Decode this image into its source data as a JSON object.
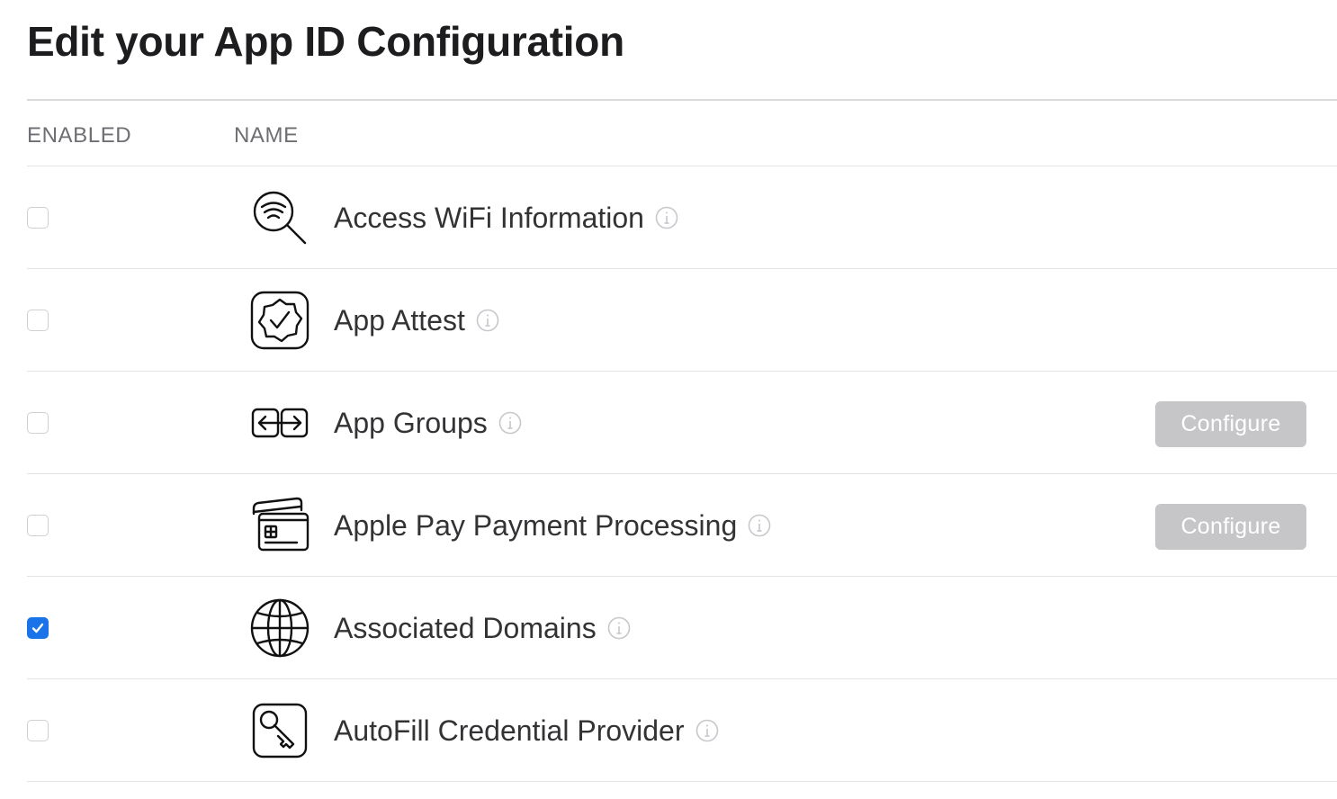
{
  "page": {
    "title": "Edit your App ID Configuration"
  },
  "table": {
    "columns": {
      "enabled": "ENABLED",
      "name": "NAME"
    },
    "rows": [
      {
        "name": "Access WiFi Information",
        "enabled": false,
        "icon": "wifi-search-icon",
        "configure_label": null
      },
      {
        "name": "App Attest",
        "enabled": false,
        "icon": "badge-check-icon",
        "configure_label": null
      },
      {
        "name": "App Groups",
        "enabled": false,
        "icon": "app-groups-icon",
        "configure_label": "Configure"
      },
      {
        "name": "Apple Pay Payment Processing",
        "enabled": false,
        "icon": "payment-cards-icon",
        "configure_label": "Configure"
      },
      {
        "name": "Associated Domains",
        "enabled": true,
        "icon": "globe-icon",
        "configure_label": null
      },
      {
        "name": "AutoFill Credential Provider",
        "enabled": false,
        "icon": "key-icon",
        "configure_label": null
      }
    ]
  },
  "colors": {
    "checkbox_checked": "#1a73e8",
    "configure_disabled_bg": "#c6c6c9",
    "header_text": "#6e6e73"
  }
}
